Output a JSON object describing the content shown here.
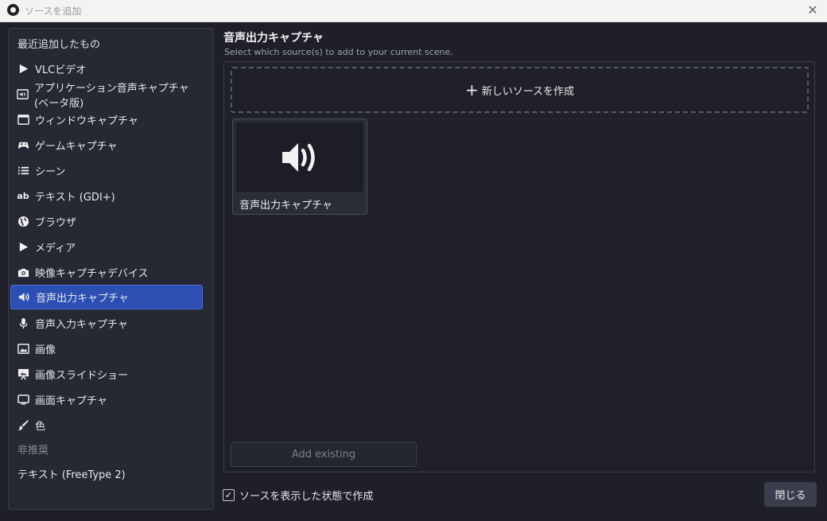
{
  "window": {
    "title": "ソースを追加",
    "close_icon": "close-icon"
  },
  "sidebar": {
    "recent_header": "最近追加したもの",
    "items": [
      {
        "label": "VLCビデオ",
        "icon": "play-icon"
      },
      {
        "label": "アプリケーション音声キャプチャ (ベータ版)",
        "icon": "app-audio-icon"
      },
      {
        "label": "ウィンドウキャプチャ",
        "icon": "window-icon"
      },
      {
        "label": "ゲームキャプチャ",
        "icon": "gamepad-icon"
      },
      {
        "label": "シーン",
        "icon": "list-icon"
      },
      {
        "label": "テキスト (GDI+)",
        "icon": "text-icon"
      },
      {
        "label": "ブラウザ",
        "icon": "globe-icon"
      },
      {
        "label": "メディア",
        "icon": "play-icon"
      },
      {
        "label": "映像キャプチャデバイス",
        "icon": "camera-icon"
      },
      {
        "label": "音声出力キャプチャ",
        "icon": "speaker-icon",
        "selected": true
      },
      {
        "label": "音声入力キャプチャ",
        "icon": "microphone-icon"
      },
      {
        "label": "画像",
        "icon": "image-icon"
      },
      {
        "label": "画像スライドショー",
        "icon": "slideshow-icon"
      },
      {
        "label": "画面キャプチャ",
        "icon": "monitor-icon"
      },
      {
        "label": "色",
        "icon": "brush-icon"
      }
    ],
    "deprecated_header": "非推奨",
    "deprecated_items": [
      "テキスト (FreeType 2)"
    ]
  },
  "main": {
    "title": "音声出力キャプチャ",
    "subtitle": "Select which source(s) to add to your current scene.",
    "create_new_label": "新しいソースを作成",
    "sources": [
      {
        "label": "音声出力キャプチャ",
        "icon": "speaker-icon"
      }
    ],
    "add_existing_label": "Add existing"
  },
  "footer": {
    "visible_checkbox_label": "ソースを表示した状態で作成",
    "visible_checked": true,
    "close_label": "閉じる"
  },
  "colors": {
    "background": "#1e1f29",
    "selected": "#2c4fb4",
    "panel_border": "#3a3d4a"
  }
}
